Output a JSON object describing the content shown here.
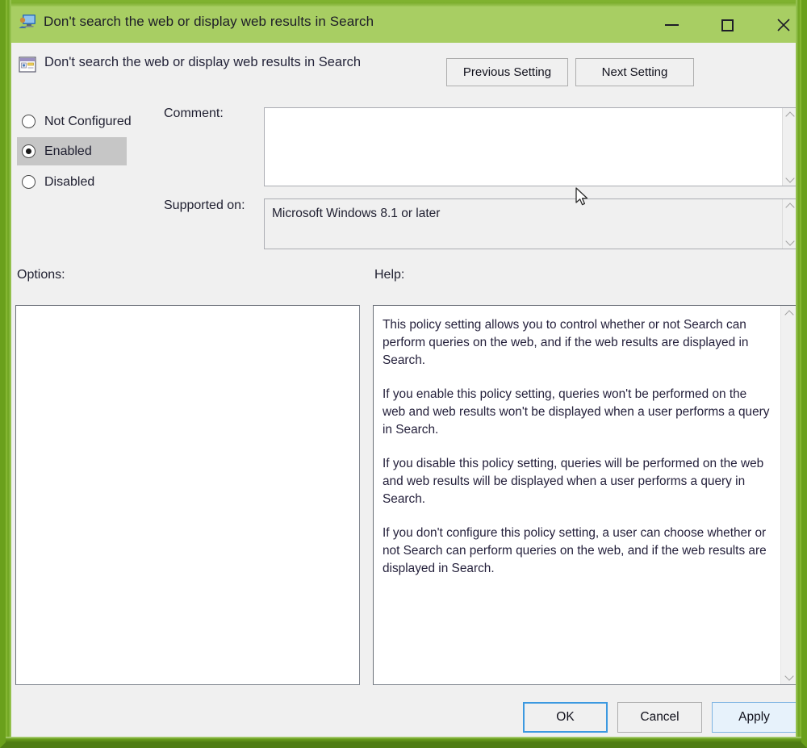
{
  "window": {
    "title": "Don't search the web or display web results in Search",
    "title_icon": "policy-user-monitor-icon",
    "accent_color": "#a8ce63",
    "border_color": "#6aa01c"
  },
  "titlebar_buttons": {
    "minimize": "minimize-icon",
    "maximize": "maximize-icon",
    "close": "✕"
  },
  "header": {
    "icon": "policy-setting-icon",
    "title": "Don't search the web or display web results in Search",
    "previous_setting_label": "Previous Setting",
    "next_setting_label": "Next Setting"
  },
  "state_options": {
    "selected": "Enabled",
    "items": [
      {
        "label": "Not Configured",
        "checked": false
      },
      {
        "label": "Enabled",
        "checked": true
      },
      {
        "label": "Disabled",
        "checked": false
      }
    ]
  },
  "fields": {
    "comment_label": "Comment:",
    "comment_value": "",
    "supported_label": "Supported on:",
    "supported_value": "Microsoft Windows 8.1 or later"
  },
  "panels": {
    "options_label": "Options:",
    "options_content": "",
    "help_label": "Help:",
    "help_paragraphs": [
      "This policy setting allows you to control whether or not Search can perform queries on the web, and if the web results are displayed in Search.",
      "If you enable this policy setting, queries won't be performed on the web and web results won't be displayed when a user performs a query in Search.",
      "If you disable this policy setting, queries will be performed on the web and web results will be displayed when a user performs a query in Search.",
      "If you don't configure this policy setting, a user can choose whether or not Search can perform queries on the web, and if the web results are displayed in Search."
    ]
  },
  "footer": {
    "ok_label": "OK",
    "cancel_label": "Cancel",
    "apply_label": "Apply"
  }
}
